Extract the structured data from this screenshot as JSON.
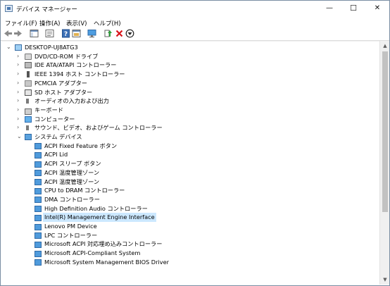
{
  "window": {
    "title": "デバイス マネージャー",
    "minimize": "—",
    "maximize": "☐",
    "close": "✕"
  },
  "menu": [
    {
      "label": "ファイル(F)"
    },
    {
      "label": "操作(A)"
    },
    {
      "label": "表示(V)"
    },
    {
      "label": "ヘルプ(H)"
    }
  ],
  "toolbar": {
    "buttons": [
      "back-icon",
      "forward-icon",
      "show-hide-console-tree-icon",
      "properties-icon",
      "help-icon",
      "view-icon",
      "scan-hardware-icon",
      "update-driver-icon",
      "uninstall-icon",
      "disable-icon"
    ]
  },
  "tree": {
    "root": "DESKTOP-UJ8ATG3",
    "categories": [
      {
        "label": "DVD/CD-ROM ドライブ",
        "icon": "dvd-icon"
      },
      {
        "label": "IDE ATA/ATAPI コントローラー",
        "icon": "ide-icon"
      },
      {
        "label": "IEEE 1394 ホスト コントローラー",
        "icon": "ieee1394-icon"
      },
      {
        "label": "PCMCIA アダプター",
        "icon": "pcmcia-icon"
      },
      {
        "label": "SD ホスト アダプター",
        "icon": "sd-icon"
      },
      {
        "label": "オーディオの入力および出力",
        "icon": "audio-io-icon"
      },
      {
        "label": "キーボード",
        "icon": "keyboard-icon"
      },
      {
        "label": "コンピューター",
        "icon": "computer-icon"
      },
      {
        "label": "サウンド、ビデオ、およびゲーム コントローラー",
        "icon": "sound-icon"
      },
      {
        "label": "システム デバイス",
        "icon": "system-devices-icon"
      }
    ],
    "system_devices": [
      "ACPI Fixed Feature ボタン",
      "ACPI Lid",
      "ACPI スリープ ボタン",
      "ACPI 温度管理ゾーン",
      "ACPI 温度管理ゾーン",
      "CPU to DRAM コントローラー",
      "DMA コントローラー",
      "High Definition Audio コントローラー",
      "Intel(R) Management Engine Interface",
      "Lenovo PM Device",
      "LPC コントローラー",
      "Microsoft ACPI 対応埋め込みコントローラー",
      "Microsoft ACPI-Compliant System",
      "Microsoft System Management BIOS Driver"
    ],
    "selected": "Intel(R) Management Engine Interface",
    "expand_collapsed": "›",
    "expand_open": "⌄",
    "root_open": "⌄"
  },
  "scrollbar": {
    "up": "▲",
    "down": "▼"
  }
}
